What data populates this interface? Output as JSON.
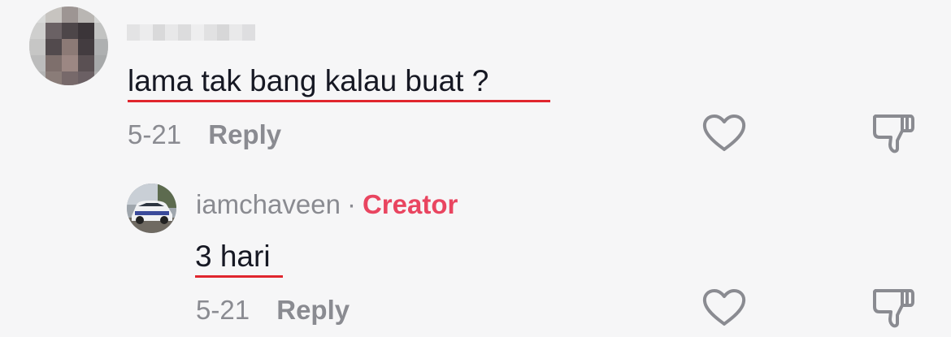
{
  "comment": {
    "avatar": "blurred-avatar",
    "username_display": "blurred-username",
    "text": "lama tak bang kalau buat ?",
    "date": "5-21",
    "reply_label": "Reply",
    "like_icon": "heart-outline-icon",
    "dislike_icon": "thumbs-down-icon"
  },
  "reply": {
    "avatar": "car-photo-avatar",
    "username": "iamchaveen",
    "separator": "·",
    "badge": "Creator",
    "text": "3 hari",
    "date": "5-21",
    "reply_label": "Reply",
    "like_icon": "heart-outline-icon",
    "dislike_icon": "thumbs-down-icon"
  },
  "colors": {
    "background": "#f6f6f7",
    "text_primary": "#161823",
    "text_secondary": "#8a8b91",
    "creator_badge": "#e94560",
    "annotation_underline": "#e0262e",
    "icon_stroke": "#8a8b91"
  }
}
